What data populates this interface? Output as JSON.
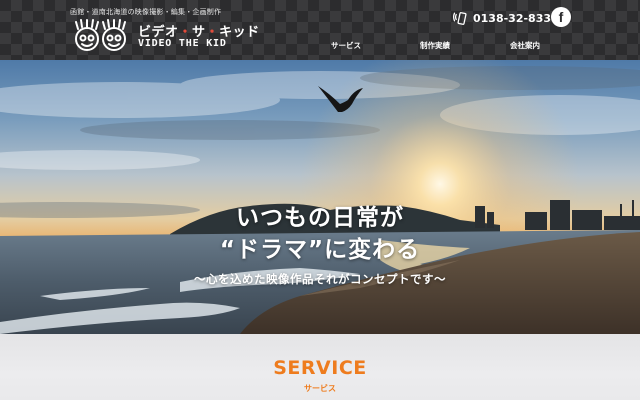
{
  "header": {
    "tagline": "函館・道南北海道の映像撮影・編集・企画制作",
    "logo": {
      "name_jp_1": "ビデオ",
      "name_jp_sep": "・",
      "name_jp_2": "サ",
      "name_jp_3": "キッド",
      "name_en": "VIDEO THE KID"
    },
    "phone": "0138-32-8334",
    "facebook_icon": "facebook-icon",
    "nav": [
      {
        "label": "サービス"
      },
      {
        "label": "制作実績"
      },
      {
        "label": "会社案内"
      }
    ]
  },
  "hero": {
    "title_line1": "いつもの日常が",
    "title_line2": "“ドラマ”に変わる",
    "subtitle": "〜心を込めた映像作品それがコンセプトです〜"
  },
  "service": {
    "heading": "SERVICE",
    "subheading": "サービス"
  },
  "colors": {
    "header_bg": "#2c2c2e",
    "accent": "#ee7c1e",
    "logo_dot": "#e24b3b"
  }
}
